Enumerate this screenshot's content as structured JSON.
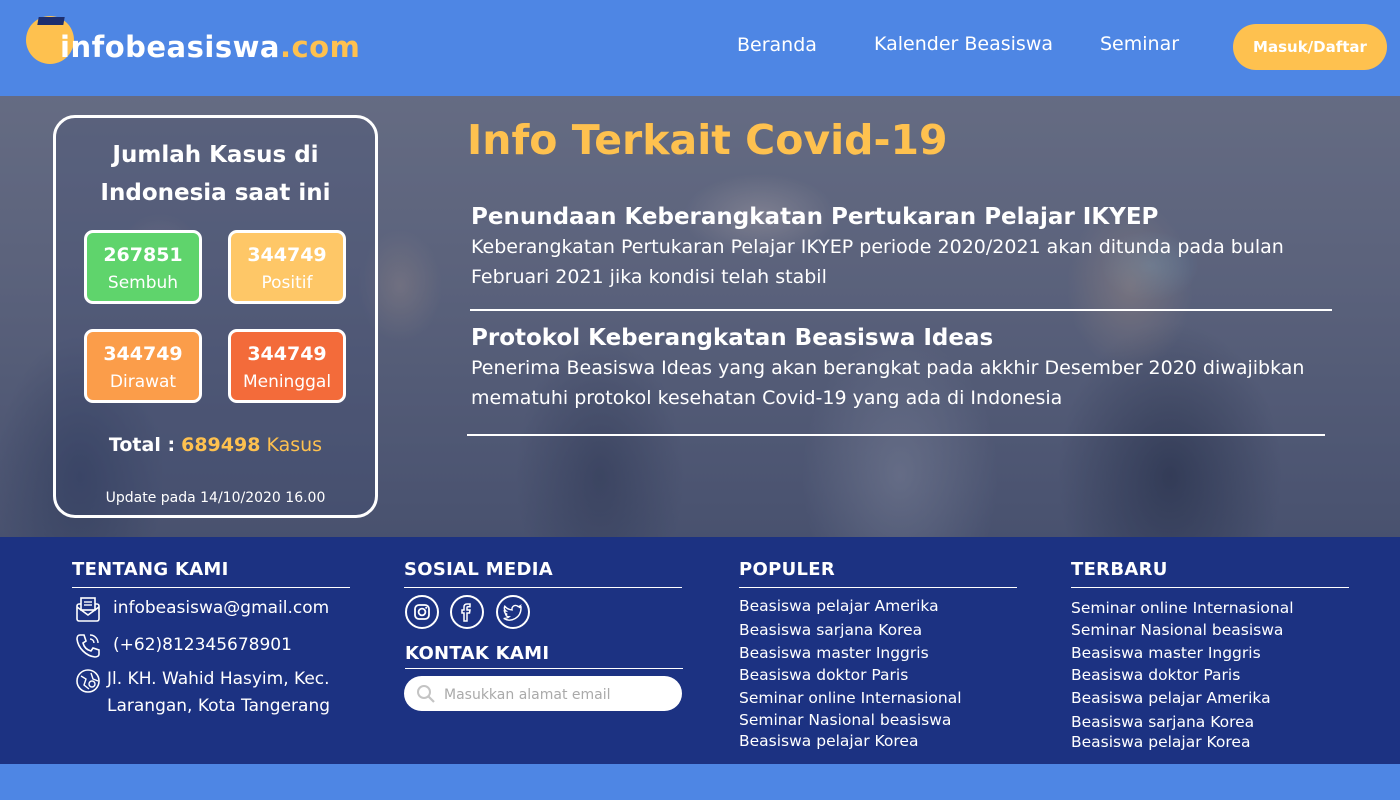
{
  "header": {
    "logo": {
      "brand": "infobeasiswa",
      "domain": ".com"
    },
    "nav": [
      {
        "label": "Beranda"
      },
      {
        "label": "Kalender Beasiswa"
      },
      {
        "label": "Seminar"
      }
    ],
    "login_label": "Masuk/Daftar"
  },
  "cases": {
    "title": "Jumlah Kasus di Indonesia saat ini",
    "stats": [
      {
        "value": "267851",
        "label": "Sembuh",
        "color": "#5fd46c"
      },
      {
        "value": "344749",
        "label": "Positif",
        "color": "#fec767"
      },
      {
        "value": "344749",
        "label": "Dirawat",
        "color": "#fb9d4a"
      },
      {
        "value": "344749",
        "label": "Meninggal",
        "color": "#f36b3a"
      }
    ],
    "total_label": "Total :",
    "total_value": "689498",
    "total_unit": "Kasus",
    "updated": "Update pada 14/10/2020 16.00"
  },
  "info": {
    "title": "Info Terkait Covid-19",
    "news": [
      {
        "title": "Penundaan Keberangkatan Pertukaran Pelajar IKYEP",
        "desc": "Keberangkatan Pertukaran Pelajar IKYEP periode 2020/2021 akan ditunda pada bulan Februari 2021 jika kondisi telah stabil"
      },
      {
        "title": "Protokol Keberangkatan Beasiswa Ideas",
        "desc": "Penerima Beasiswa Ideas yang akan berangkat pada akkhir Desember 2020 diwajibkan mematuhi protokol kesehatan Covid-19 yang ada di Indonesia"
      }
    ]
  },
  "footer": {
    "about": {
      "title": "TENTANG KAMI",
      "email": "infobeasiswa@gmail.com",
      "phone": "(+62)812345678901",
      "address_line1": "Jl. KH. Wahid Hasyim, Kec.",
      "address_line2": "Larangan, Kota Tangerang"
    },
    "social": {
      "title": "SOSIAL MEDIA",
      "icons": [
        "instagram-icon",
        "facebook-icon",
        "twitter-icon"
      ]
    },
    "contact": {
      "title": "KONTAK KAMI",
      "placeholder": "Masukkan alamat email"
    },
    "popular": {
      "title": "POPULER",
      "items": [
        "Beasiswa pelajar Amerika",
        "Beasiswa sarjana Korea",
        "Beasiswa master Inggris",
        "Beasiswa doktor Paris",
        "Seminar online Internasional",
        "Seminar Nasional beasiswa",
        "Beasiswa pelajar Korea"
      ]
    },
    "latest": {
      "title": "TERBARU",
      "items": [
        "Seminar online Internasional",
        "Seminar Nasional beasiswa",
        "Beasiswa master Inggris",
        "Beasiswa doktor Paris",
        "Beasiswa pelajar Amerika",
        "Beasiswa sarjana Korea",
        "Beasiswa pelajar Korea"
      ]
    }
  },
  "colors": {
    "primary": "#4e86e4",
    "accent": "#fec14f",
    "footer": "#1c3282"
  }
}
